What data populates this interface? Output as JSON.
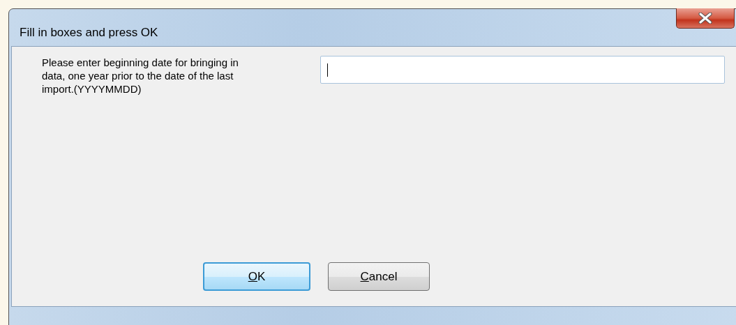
{
  "window": {
    "title": "Fill in boxes and press OK"
  },
  "prompt": {
    "label": "Please enter beginning date for bringing in data, one year prior to the date of the last import.(YYYYMMDD)"
  },
  "buttons": [
    {
      "label": "OK",
      "default": true
    },
    {
      "label": "Cancel",
      "default": false
    }
  ]
}
